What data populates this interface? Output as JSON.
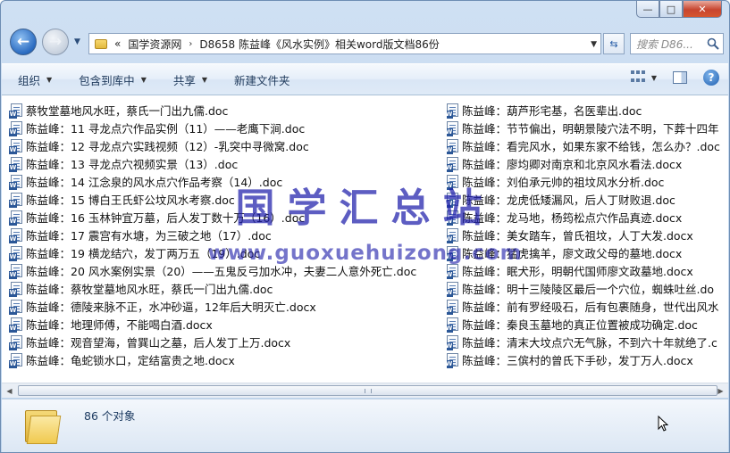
{
  "window": {
    "minimize_glyph": "—",
    "maximize_glyph": "□",
    "close_glyph": "✕"
  },
  "address": {
    "overflow": "«",
    "crumbs": [
      "国学资源网",
      "D8658 陈益峰《风水实例》相关word版文档86份"
    ],
    "separator": "›"
  },
  "search": {
    "placeholder": "搜索 D86..."
  },
  "toolbar": {
    "organize": "组织",
    "include_in_library": "包含到库中",
    "share": "共享",
    "new_folder": "新建文件夹"
  },
  "files_left": [
    "蔡牧堂墓地风水旺，蔡氏一门出九儒.doc",
    "陈益峰：11  寻龙点穴作品实例（11）——老鹰下涧.doc",
    "陈益峰：12  寻龙点穴实践视频（12）-乳突中寻微窝.doc",
    "陈益峰：13  寻龙点穴视频实景（13）.doc",
    "陈益峰：14  江念泉的风水点穴作品考察（14）.doc",
    "陈益峰：15  博白王氏虾公坟风水考察.doc",
    "陈益峰：16  玉林钟宜万墓，后人发丁数十万（16）.doc",
    "陈益峰：17  震宫有水塘，为三破之地（17）.doc",
    "陈益峰：19  横龙结穴，发丁两万五（19）.doc",
    "陈益峰：20  风水案例实景（20）——五鬼反弓加水冲，夫妻二人意外死亡.doc",
    "陈益峰：蔡牧堂墓地风水旺，蔡氏一门出九儒.doc",
    "陈益峰：德陵来脉不正，水冲砂逼，12年后大明灭亡.docx",
    "陈益峰：地理师傅，不能喝白酒.docx",
    "陈益峰：观音望海，曾巽山之墓，后人发丁上万.docx",
    "陈益峰：龟蛇锁水口，定结富贵之地.docx"
  ],
  "files_right": [
    "陈益峰：葫芦形宅基，名医辈出.doc",
    "陈益峰：节节偏出，明朝景陵穴法不明，下葬十四年",
    "陈益峰：看完风水，如果东家不给钱，怎么办？.doc",
    "陈益峰：廖均卿对南京和北京风水看法.docx",
    "陈益峰：刘伯承元帅的祖坟风水分析.doc",
    "陈益峰：龙虎低矮漏风，后人丁财败退.doc",
    "陈益峰：龙马地，杨筠松点穴作品真迹.docx",
    "陈益峰：美女踏车，曾氏祖坟，人丁大发.docx",
    "陈益峰：猛虎擒羊，廖文政父母的墓地.docx",
    "陈益峰：眠犬形，明朝代国师廖文政墓地.docx",
    "陈益峰：明十三陵陵区最后一个穴位，蜘蛛吐丝.do",
    "陈益峰：前有罗经吸石，后有包裹随身，世代出风水",
    "陈益峰：秦良玉墓地的真正位置被成功确定.doc",
    "陈益峰：清末大坟点穴无气脉，不到六十年就绝了.c",
    "陈益峰：三傧村的曾氏下手砂，发丁万人.docx"
  ],
  "watermark": {
    "text": "国学汇总站",
    "url": "www.guoxuehuizong.com"
  },
  "status": {
    "count_text": "86 个对象"
  },
  "icons": {
    "back": "back-arrow-icon",
    "forward": "forward-arrow-icon",
    "folder": "folder-icon",
    "document": "word-document-icon",
    "search": "search-icon",
    "refresh": "refresh-icon",
    "views": "views-icon",
    "preview_pane": "preview-pane-icon",
    "help": "help-icon",
    "cursor": "mouse-cursor-icon"
  },
  "colors": {
    "chrome": "#c4d8ef",
    "toolbar_text": "#1e395b",
    "watermark": "#1e1eaa",
    "close_button": "#c7452f"
  }
}
